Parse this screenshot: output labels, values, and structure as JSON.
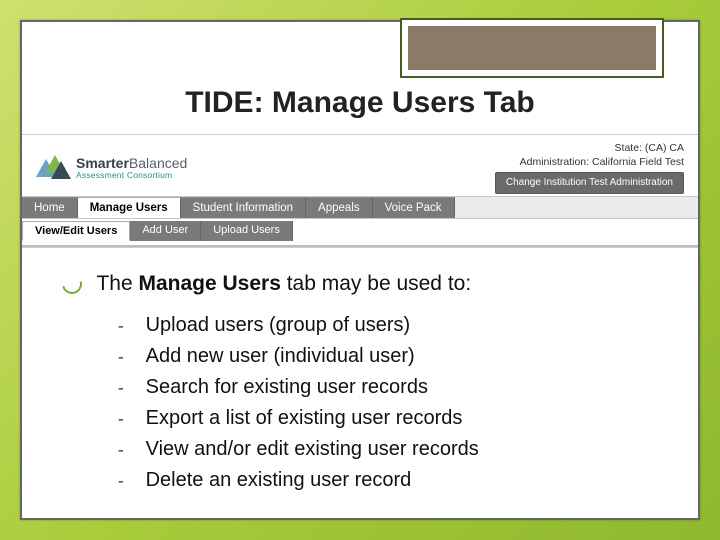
{
  "title": "TIDE: Manage Users Tab",
  "logo": {
    "line1_a": "Smarter",
    "line1_b": "Balanced",
    "line2": "Assessment Consortium"
  },
  "admin": {
    "state_label": "State:",
    "state_value": "(CA) CA",
    "admin_label": "Administration:",
    "admin_value": "California Field Test",
    "change_button": "Change Institution Test Administration"
  },
  "tabs_main": [
    "Home",
    "Manage Users",
    "Student Information",
    "Appeals",
    "Voice Pack"
  ],
  "tabs_main_active": 1,
  "tabs_sub": [
    "View/Edit Users",
    "Add User",
    "Upload Users"
  ],
  "tabs_sub_active": 0,
  "intro": {
    "pre": "The ",
    "bold": "Manage Users",
    "post": " tab may be used to:"
  },
  "bullets": [
    "Upload users (group of users)",
    "Add new user (individual user)",
    "Search for existing user records",
    "Export a list of existing user records",
    "View and/or edit existing user records",
    "Delete an existing user record"
  ]
}
